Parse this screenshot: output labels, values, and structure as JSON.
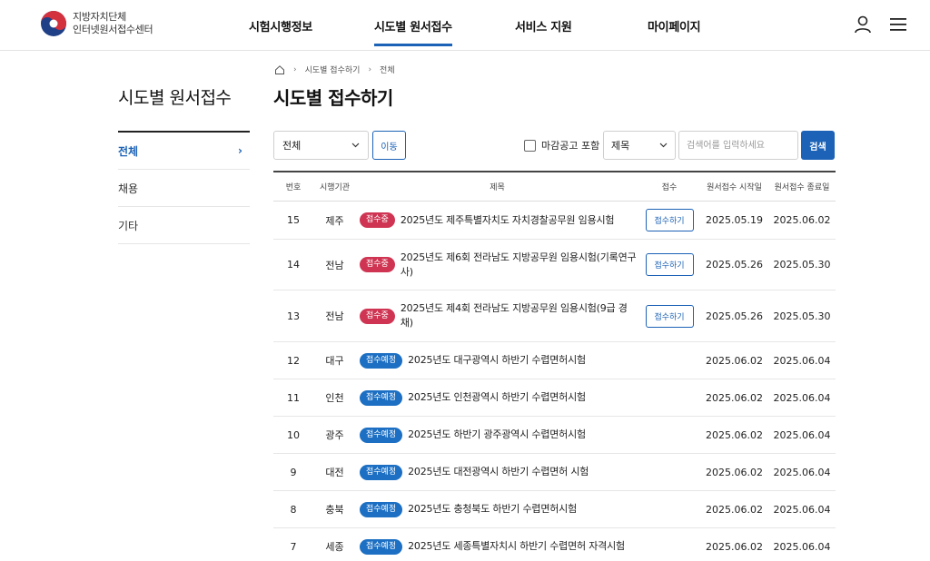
{
  "header": {
    "logo_line1": "지방자치단체",
    "logo_line2": "인터넷원서접수센터",
    "nav": [
      "시험시행정보",
      "시도별 원서접수",
      "서비스 지원",
      "마이페이지"
    ],
    "active_nav": "시도별 원서접수"
  },
  "sidebar": {
    "title": "시도별 원서접수",
    "items": [
      {
        "label": "전체",
        "active": true
      },
      {
        "label": "채용",
        "active": false
      },
      {
        "label": "기타",
        "active": false
      }
    ]
  },
  "breadcrumb": [
    "시도별 접수하기",
    "전체"
  ],
  "page_title": "시도별 접수하기",
  "filter": {
    "category_value": "전체",
    "move_label": "이동",
    "include_closed_label": "마감공고 포함",
    "field_value": "제목",
    "search_placeholder": "검색어를 입력하세요",
    "search_label": "검색"
  },
  "table": {
    "headers": [
      "번호",
      "시행기관",
      "제목",
      "접수",
      "원서접수 시작일",
      "원서접수 종료일"
    ],
    "apply_label": "접수하기",
    "rows": [
      {
        "no": "15",
        "org": "제주",
        "status": "접수중",
        "title": "2025년도 제주특별자치도 자치경찰공무원 임용시험",
        "start": "2025.05.19",
        "end": "2025.06.02"
      },
      {
        "no": "14",
        "org": "전남",
        "status": "접수중",
        "title": "2025년도 제6회 전라남도 지방공무원 임용시험(기록연구사)",
        "start": "2025.05.26",
        "end": "2025.05.30"
      },
      {
        "no": "13",
        "org": "전남",
        "status": "접수중",
        "title": "2025년도 제4회 전라남도 지방공무원 임용시험(9급 경채)",
        "start": "2025.05.26",
        "end": "2025.05.30"
      },
      {
        "no": "12",
        "org": "대구",
        "status": "접수예정",
        "title": "2025년도 대구광역시 하반기 수렵면허시험",
        "start": "2025.06.02",
        "end": "2025.06.04"
      },
      {
        "no": "11",
        "org": "인천",
        "status": "접수예정",
        "title": "2025년도 인천광역시 하반기 수렵면허시험",
        "start": "2025.06.02",
        "end": "2025.06.04"
      },
      {
        "no": "10",
        "org": "광주",
        "status": "접수예정",
        "title": "2025년도 하반기 광주광역시 수렵면허시험",
        "start": "2025.06.02",
        "end": "2025.06.04"
      },
      {
        "no": "9",
        "org": "대전",
        "status": "접수예정",
        "title": "2025년도 대전광역시 하반기 수렵면허 시험",
        "start": "2025.06.02",
        "end": "2025.06.04"
      },
      {
        "no": "8",
        "org": "충북",
        "status": "접수예정",
        "title": "2025년도 충청북도 하반기 수렵면허시험",
        "start": "2025.06.02",
        "end": "2025.06.04"
      },
      {
        "no": "7",
        "org": "세종",
        "status": "접수예정",
        "title": "2025년도 세종특별자치시 하반기 수렵면허 자격시험",
        "start": "2025.06.02",
        "end": "2025.06.04"
      }
    ]
  },
  "colors": {
    "primary": "#1c62b6",
    "badge_open": "#cf3552",
    "badge_soon": "#1c6fc3"
  }
}
